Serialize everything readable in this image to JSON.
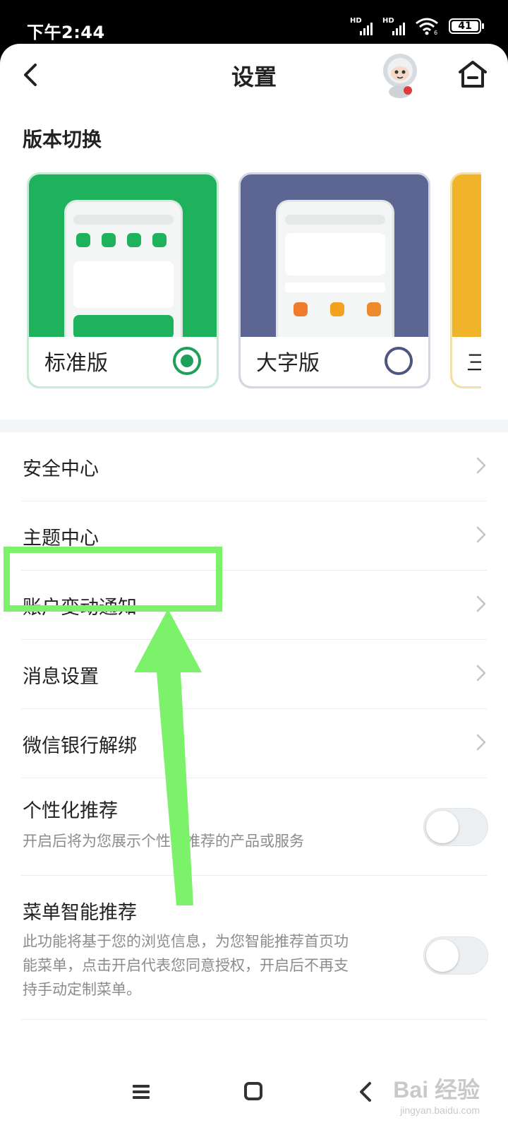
{
  "status_bar": {
    "time": "下午2:44",
    "signal1_label": "HD",
    "signal2_label": "HD",
    "wifi_label": "6",
    "battery": "41"
  },
  "header": {
    "title": "设置",
    "back_icon": "chevron-left-icon",
    "home_icon": "home-icon"
  },
  "version_switch": {
    "label": "版本切换",
    "cards": [
      {
        "label": "标准版",
        "selected": true,
        "color": "#1fb25d"
      },
      {
        "label": "大字版",
        "selected": false,
        "color": "#5d6693"
      },
      {
        "label": "三",
        "selected": false,
        "color": "#f0b32a"
      }
    ]
  },
  "settings": {
    "items": [
      {
        "label": "安全中心"
      },
      {
        "label": "主题中心"
      },
      {
        "label": "账户变动通知"
      },
      {
        "label": "消息设置"
      },
      {
        "label": "微信银行解绑"
      }
    ],
    "personalized": {
      "label": "个性化推荐",
      "desc": "开启后将为您展示个性化推荐的产品或服务",
      "enabled": false
    },
    "menu_smart": {
      "label": "菜单智能推荐",
      "desc_line1": "此功能将基于您的浏览信息，为您智能推荐首页功",
      "desc_line2": "能菜单，点击开启代表您同意授权，开启后不再支",
      "desc_line3": "持手动定制菜单。",
      "enabled": false
    }
  },
  "annotation": {
    "color": "#7cf26b"
  },
  "watermark": {
    "text": "Bai 经验",
    "sub": "jingyan.baidu.com"
  },
  "colors": {
    "accent_green": "#1ea05a",
    "chevron": "#c4c4c4"
  }
}
